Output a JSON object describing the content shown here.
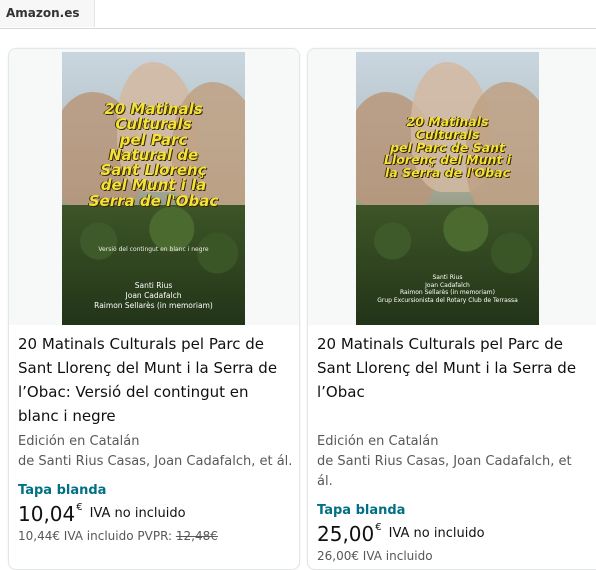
{
  "site": {
    "tab_label": "Amazon.es"
  },
  "products": [
    {
      "cover": {
        "title_lines": [
          "20 Matinals",
          "Culturals",
          "pel Parc",
          "Natural de",
          "Sant Llorenç",
          "del Munt i la",
          "Serra de l'Obac"
        ],
        "subtitle": "Versió del contingut en blanc i negre",
        "authors": [
          "Santi Rius",
          "Joan Cadafalch",
          "Raimon Sellarès (in memoriam)"
        ]
      },
      "title": "20 Matinals Culturals pel Parc de Sant Llorenç del Munt i la Serra de l’Obac: Versió del contingut en blanc i negre",
      "edition": "Edición en Catalán",
      "authors_line": "de Santi Rius Casas, Joan Cadafalch, et ál.",
      "format": "Tapa blanda",
      "price": "10,04",
      "currency": "€",
      "iva_label": "IVA no incluido",
      "secondary_price": "10,44€ IVA incluido PVPR: ",
      "pvpr": "12,48€"
    },
    {
      "cover": {
        "title_lines": [
          "20 Matinals",
          "Culturals",
          "pel Parc de Sant",
          "Llorenç del Munt i",
          "la Serra de l'Obac"
        ],
        "subtitle": "",
        "authors": [
          "Santi Rius",
          "Joan Cadafalch",
          "Raimon Sellarès (in memoriam)",
          "Grup Excursionista del Rotary Club de Terrassa"
        ]
      },
      "title": "20 Matinals Culturals pel Parc de Sant Llorenç del Munt i la Serra de l’Obac",
      "edition": "Edición en Catalán",
      "authors_line": "de Santi Rius Casas, Joan Cadafalch, et ál.",
      "format": "Tapa blanda",
      "price": "25,00",
      "currency": "€",
      "iva_label": "IVA no incluido",
      "secondary_price": "26,00€ IVA incluido"
    }
  ]
}
